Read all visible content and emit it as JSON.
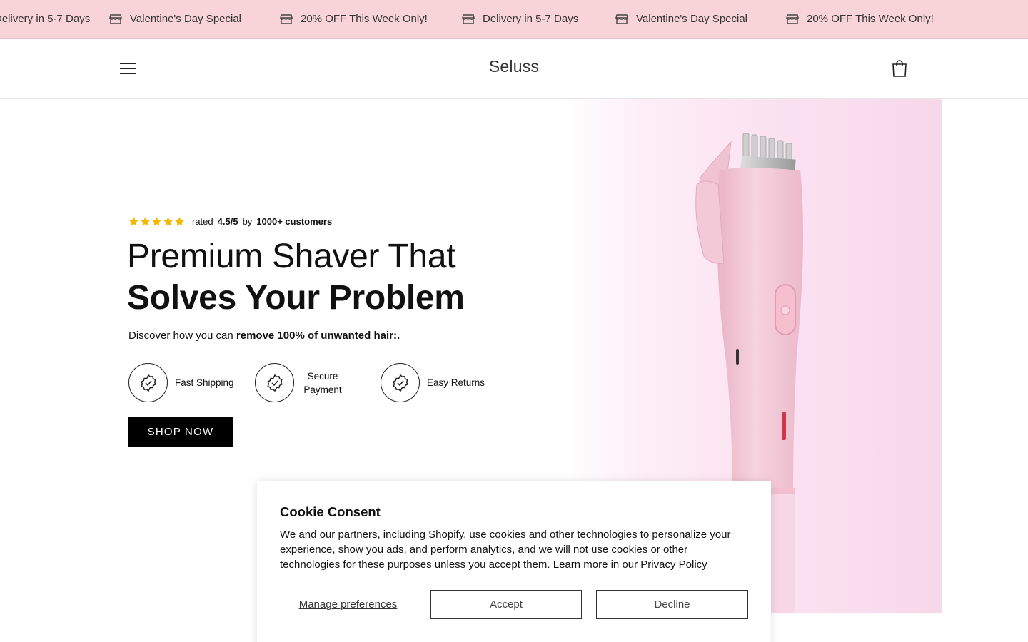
{
  "announcement": {
    "items": [
      {
        "text": "Delivery in 5-7 Days",
        "icon": "storefront-icon"
      },
      {
        "text": "Valentine's Day Special",
        "icon": "storefront-icon"
      },
      {
        "text": "20% OFF This Week Only!",
        "icon": "storefront-icon"
      },
      {
        "text": "Delivery in 5-7 Days",
        "icon": "storefront-icon"
      },
      {
        "text": "Valentine's Day Special",
        "icon": "storefront-icon"
      },
      {
        "text": "20% OFF This Week Only!",
        "icon": "storefront-icon"
      }
    ]
  },
  "header": {
    "logo": "Seluss",
    "menu_icon": "hamburger-menu-icon",
    "cart_icon": "shopping-bag-icon"
  },
  "hero": {
    "rating": {
      "stars": 5,
      "word": "rated",
      "score": "4.5/5",
      "by": "by",
      "customers": "1000+ customers",
      "star_color": "#f5b800"
    },
    "headline_line1": "Premium Shaver That",
    "headline_line2": "Solves Your Problem",
    "subline_prefix": "Discover how you can",
    "subline_bold": "remove 100% of unwanted hair:.",
    "features": [
      {
        "label": "Fast Shipping",
        "icon": "badge-check-icon"
      },
      {
        "label": "Secure Payment",
        "icon": "badge-check-icon"
      },
      {
        "label": "Easy Returns",
        "icon": "badge-check-icon"
      }
    ],
    "cta_label": "SHOP NOW",
    "image_subject": "pink electric shaver on pink background"
  },
  "cookie": {
    "title": "Cookie Consent",
    "body": "We and our partners, including Shopify, use cookies and other technologies to personalize your experience, show you ads, and perform analytics, and we will not use cookies or other technologies for these purposes unless you accept them. Learn more in our",
    "policy_link": "Privacy Policy",
    "manage_label": "Manage preferences",
    "accept_label": "Accept",
    "decline_label": "Decline"
  },
  "colors": {
    "announcement_bg": "#f8d3d7",
    "cta_bg": "#000000",
    "hero_image_bg": "#fbe2f1",
    "product_pink": "#f2c3d3"
  }
}
